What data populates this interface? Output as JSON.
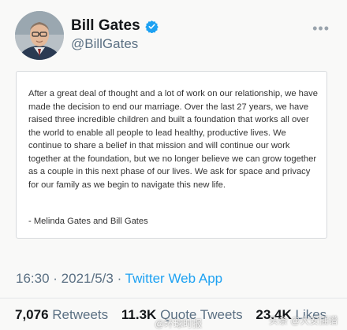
{
  "profile": {
    "name": "Bill Gates",
    "handle": "@BillGates"
  },
  "quote": {
    "text": "After a great deal of thought and a lot of work on our relationship, we have made the decision to end our marriage. Over the last 27 years, we have raised three incredible children and built a foundation that works all over the world to enable all people to lead healthy, productive lives. We continue to share a belief in that mission and will continue our work together at the foundation, but we no longer believe we can grow together as a couple in this next phase of our lives. We ask for space and privacy for our family as we begin to navigate this new life.",
    "signature": "- Melinda Gates and Bill Gates"
  },
  "meta": {
    "time": "16:30",
    "separator1": " · ",
    "date": "2021/5/3",
    "separator2": " · ",
    "source": "Twitter Web App"
  },
  "stats": {
    "retweets_count": "7,076",
    "retweets_label": "Retweets",
    "quotes_count": "11.3K",
    "quotes_label": "Quote Tweets",
    "likes_count": "23.4K",
    "likes_label": "Likes"
  },
  "watermarks": {
    "center": "@环球时报",
    "right": "头条 @大安插谱"
  },
  "colors": {
    "accent": "#1da1f2",
    "secondary_text": "#5b7083"
  },
  "icons": {
    "verified": "verified-badge-icon",
    "more": "more-options-icon"
  }
}
